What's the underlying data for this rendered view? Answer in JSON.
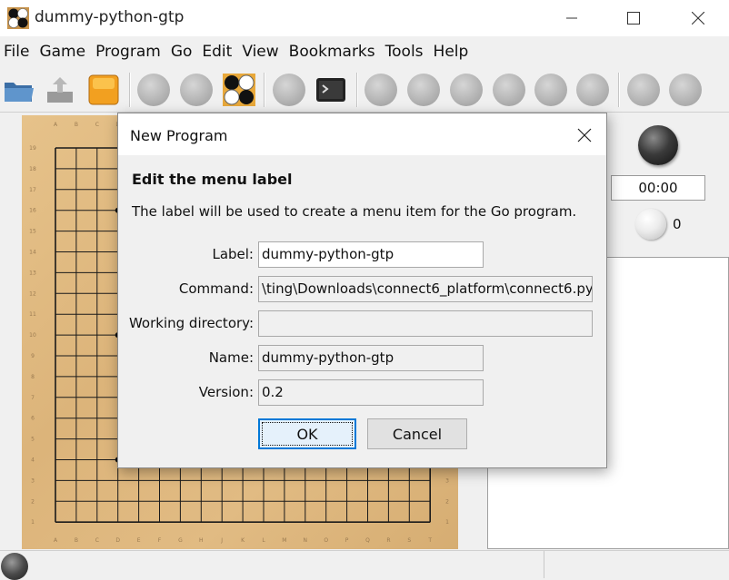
{
  "window": {
    "title": "dummy-python-gtp",
    "app_icon": "go-board-app-icon",
    "controls": [
      "minimize-icon",
      "maximize-icon",
      "close-icon"
    ]
  },
  "menu": [
    "File",
    "Game",
    "Program",
    "Go",
    "Edit",
    "View",
    "Bookmarks",
    "Tools",
    "Help"
  ],
  "toolbar": {
    "icons": [
      "open-folder-icon",
      "save-icon",
      "new-game-icon",
      "play-icon",
      "setup-icon",
      "board-editor-icon",
      "interrupt-icon",
      "gtp-shell-icon",
      "beginning-icon",
      "backward-10-icon",
      "backward-icon",
      "forward-icon",
      "forward-10-icon",
      "end-icon",
      "next-variation-icon",
      "previous-variation-icon"
    ]
  },
  "board": {
    "coord_letters": [
      "A",
      "B",
      "C",
      "D",
      "E",
      "F",
      "G",
      "H",
      "J",
      "K",
      "L",
      "M",
      "N",
      "O",
      "P",
      "Q",
      "R",
      "S",
      "T"
    ]
  },
  "right_panel": {
    "clock": "00:00",
    "captured_count": "0"
  },
  "dialog": {
    "title": "New Program",
    "heading": "Edit the menu label",
    "description": "The label will be used to create a menu item for the Go program.",
    "fields": {
      "label": {
        "label": "Label:",
        "value": "dummy-python-gtp"
      },
      "command": {
        "label": "Command:",
        "value": "\\ting\\Downloads\\connect6_platform\\connect6.py\""
      },
      "working_directory": {
        "label": "Working directory:",
        "value": ""
      },
      "name": {
        "label": "Name:",
        "value": "dummy-python-gtp"
      },
      "version": {
        "label": "Version:",
        "value": "0.2"
      }
    },
    "ok_label": "OK",
    "cancel_label": "Cancel"
  },
  "colors": {
    "board": "#e0b880",
    "focus_accent": "#0078d7"
  }
}
